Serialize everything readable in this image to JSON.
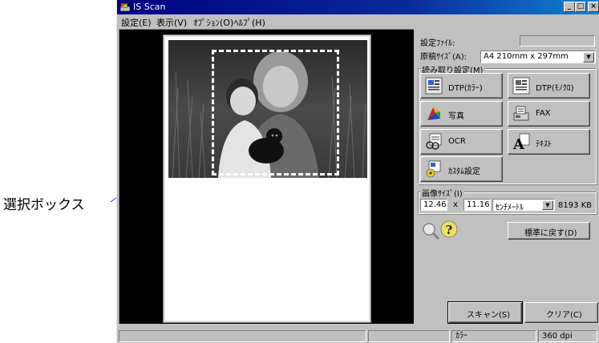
{
  "annotation": {
    "label": "選択ボックス"
  },
  "window": {
    "title": "IS Scan",
    "minimize": "_",
    "maximize": "□",
    "close": "×"
  },
  "menu": [
    "設定(E)",
    "表示(V)",
    "ｵﾌﾟｼｮﾝ(O)",
    "ﾍﾙﾌﾟ(H)"
  ],
  "settings": {
    "config_file_label": "設定ﾌｧｲﾙ:",
    "config_file_value": "",
    "doc_size_label": "原稿ｻｲｽﾞ(A):",
    "doc_size_value": "A4 210mm x 297mm",
    "read_settings_label": "読み取り設定(M)",
    "modes": [
      {
        "label": "DTP(ｶﾗｰ)",
        "icon": "dtp-color-icon"
      },
      {
        "label": "DTP(ﾓﾉｸﾛ)",
        "icon": "dtp-mono-icon"
      },
      {
        "label": "写真",
        "icon": "photo-icon"
      },
      {
        "label": "FAX",
        "icon": "fax-icon"
      },
      {
        "label": "OCR",
        "icon": "ocr-icon"
      },
      {
        "label": "ﾃｷｽﾄ",
        "icon": "text-icon"
      },
      {
        "label": "ｶｽﾀﾑ設定",
        "icon": "custom-settings-icon"
      }
    ]
  },
  "image_size": {
    "label": "画像ｻｲｽﾞ(I)",
    "width": "12.46",
    "separator": "x",
    "height": "11.16",
    "unit": "ｾﾝﾁﾒｰﾄﾙ",
    "filesize": "8193 KB"
  },
  "buttons": {
    "reset": "標準に戻す(D)",
    "scan": "スキャン(S)",
    "clear": "クリア(C)"
  },
  "status": {
    "color_mode": "ｶﾗｰ",
    "resolution": "360 dpi"
  }
}
